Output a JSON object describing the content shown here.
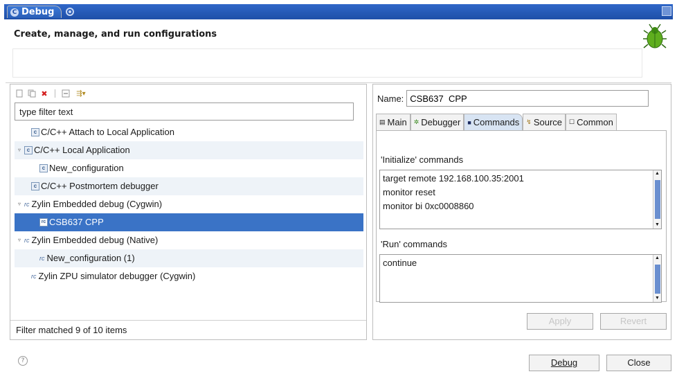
{
  "window": {
    "title": "Debug"
  },
  "header": {
    "title": "Create, manage, and run configurations"
  },
  "left": {
    "filter_placeholder": "type filter text",
    "tree": [
      {
        "label": "C/C++ Attach to Local Application",
        "indent": 1,
        "twisty": "",
        "icon": "c-config-icon"
      },
      {
        "label": "C/C++ Local Application",
        "indent": 0,
        "twisty": "▿",
        "icon": "c-config-icon"
      },
      {
        "label": "New_configuration",
        "indent": 2,
        "twisty": "",
        "icon": "c-config-icon"
      },
      {
        "label": "C/C++ Postmortem debugger",
        "indent": 1,
        "twisty": "",
        "icon": "c-config-icon"
      },
      {
        "label": "Zylin Embedded debug (Cygwin)",
        "indent": 0,
        "twisty": "▿",
        "icon": "zylin-icon"
      },
      {
        "label": "CSB637  CPP",
        "indent": 2,
        "twisty": "",
        "icon": "zylin-config-icon"
      },
      {
        "label": "Zylin Embedded debug (Native)",
        "indent": 0,
        "twisty": "▿",
        "icon": "zylin-icon"
      },
      {
        "label": "New_configuration (1)",
        "indent": 2,
        "twisty": "",
        "icon": "zylin-icon"
      },
      {
        "label": "Zylin ZPU simulator debugger (Cygwin)",
        "indent": 1,
        "twisty": "",
        "icon": "zylin-icon"
      }
    ],
    "status": "Filter matched 9 of 10 items"
  },
  "right": {
    "name_label": "Name:",
    "name_value": "CSB637  CPP",
    "tabs": [
      "Main",
      "Debugger",
      "Commands",
      "Source",
      "Common"
    ],
    "init_label": "'Initialize' commands",
    "init_commands": [
      "target remote 192.168.100.35:2001",
      "monitor reset",
      "monitor bi 0xc0008860"
    ],
    "run_label": "'Run' commands",
    "run_commands": [
      "continue"
    ],
    "apply": "Apply",
    "revert": "Revert"
  },
  "footer": {
    "debug": "Debug",
    "close": "Close",
    "help": "?"
  }
}
